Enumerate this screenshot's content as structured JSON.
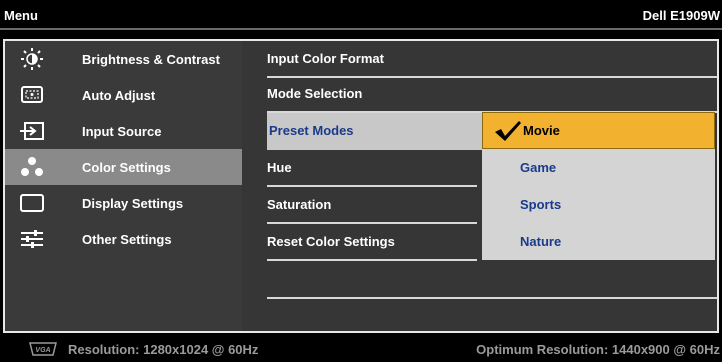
{
  "title_bar": {
    "menu_label": "Menu",
    "model": "Dell E1909W"
  },
  "left_menu": {
    "items": [
      {
        "label": "Brightness & Contrast",
        "icon": "brightness-icon",
        "active": false
      },
      {
        "label": "Auto Adjust",
        "icon": "auto-adjust-icon",
        "active": false
      },
      {
        "label": "Input Source",
        "icon": "input-source-icon",
        "active": false
      },
      {
        "label": "Color Settings",
        "icon": "color-settings-icon",
        "active": true
      },
      {
        "label": "Display Settings",
        "icon": "display-settings-icon",
        "active": false
      },
      {
        "label": "Other Settings",
        "icon": "other-settings-icon",
        "active": false
      }
    ]
  },
  "submenu": {
    "rows": [
      {
        "label": "Input Color Format"
      },
      {
        "label": "Mode Selection"
      },
      {
        "label": "Preset Modes",
        "selected": true
      },
      {
        "label": "Hue"
      },
      {
        "label": "Saturation"
      },
      {
        "label": "Reset Color Settings"
      }
    ]
  },
  "preset_options": {
    "items": [
      {
        "label": "Movie",
        "chosen": true
      },
      {
        "label": "Game"
      },
      {
        "label": "Sports"
      },
      {
        "label": "Nature"
      }
    ],
    "check_icon": "checkmark-icon"
  },
  "status_bar": {
    "input_icon": "vga-icon",
    "input_icon_text": "VGA",
    "resolution": "Resolution: 1280x1024 @ 60Hz",
    "optimum": "Optimum Resolution: 1440x900 @ 60Hz"
  },
  "colors": {
    "frame_border": "#e8e8e8",
    "menu_bg": "#3a3a3a",
    "active_bg": "#8a8a8a",
    "highlight": "#f2b230",
    "option_text": "#1a3a8a"
  }
}
